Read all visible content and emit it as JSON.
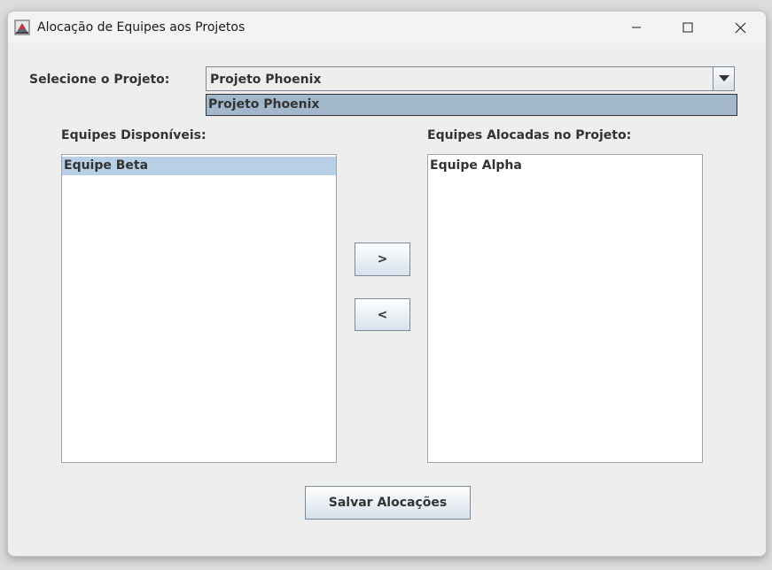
{
  "window": {
    "title": "Alocação de Equipes aos Projetos",
    "controls": [
      "minimize-icon",
      "maximize-icon",
      "close-icon"
    ]
  },
  "project_selector": {
    "label": "Selecione o Projeto:",
    "selected": "Projeto Phoenix",
    "options": [
      "Projeto Phoenix"
    ]
  },
  "available_teams": {
    "label": "Equipes Disponíveis:",
    "items": [
      "Equipe Beta"
    ],
    "selected": "Equipe Beta"
  },
  "allocated_teams": {
    "label": "Equipes Alocadas no Projeto:",
    "items": [
      "Equipe Alpha"
    ]
  },
  "transfer_buttons": {
    "add": ">",
    "remove": "<"
  },
  "save_button": {
    "label": "Salvar Alocações"
  },
  "colors": {
    "selection": "#b8cfe5",
    "popup_selection": "#a3b8cc",
    "window_bg": "#eeeeee"
  }
}
